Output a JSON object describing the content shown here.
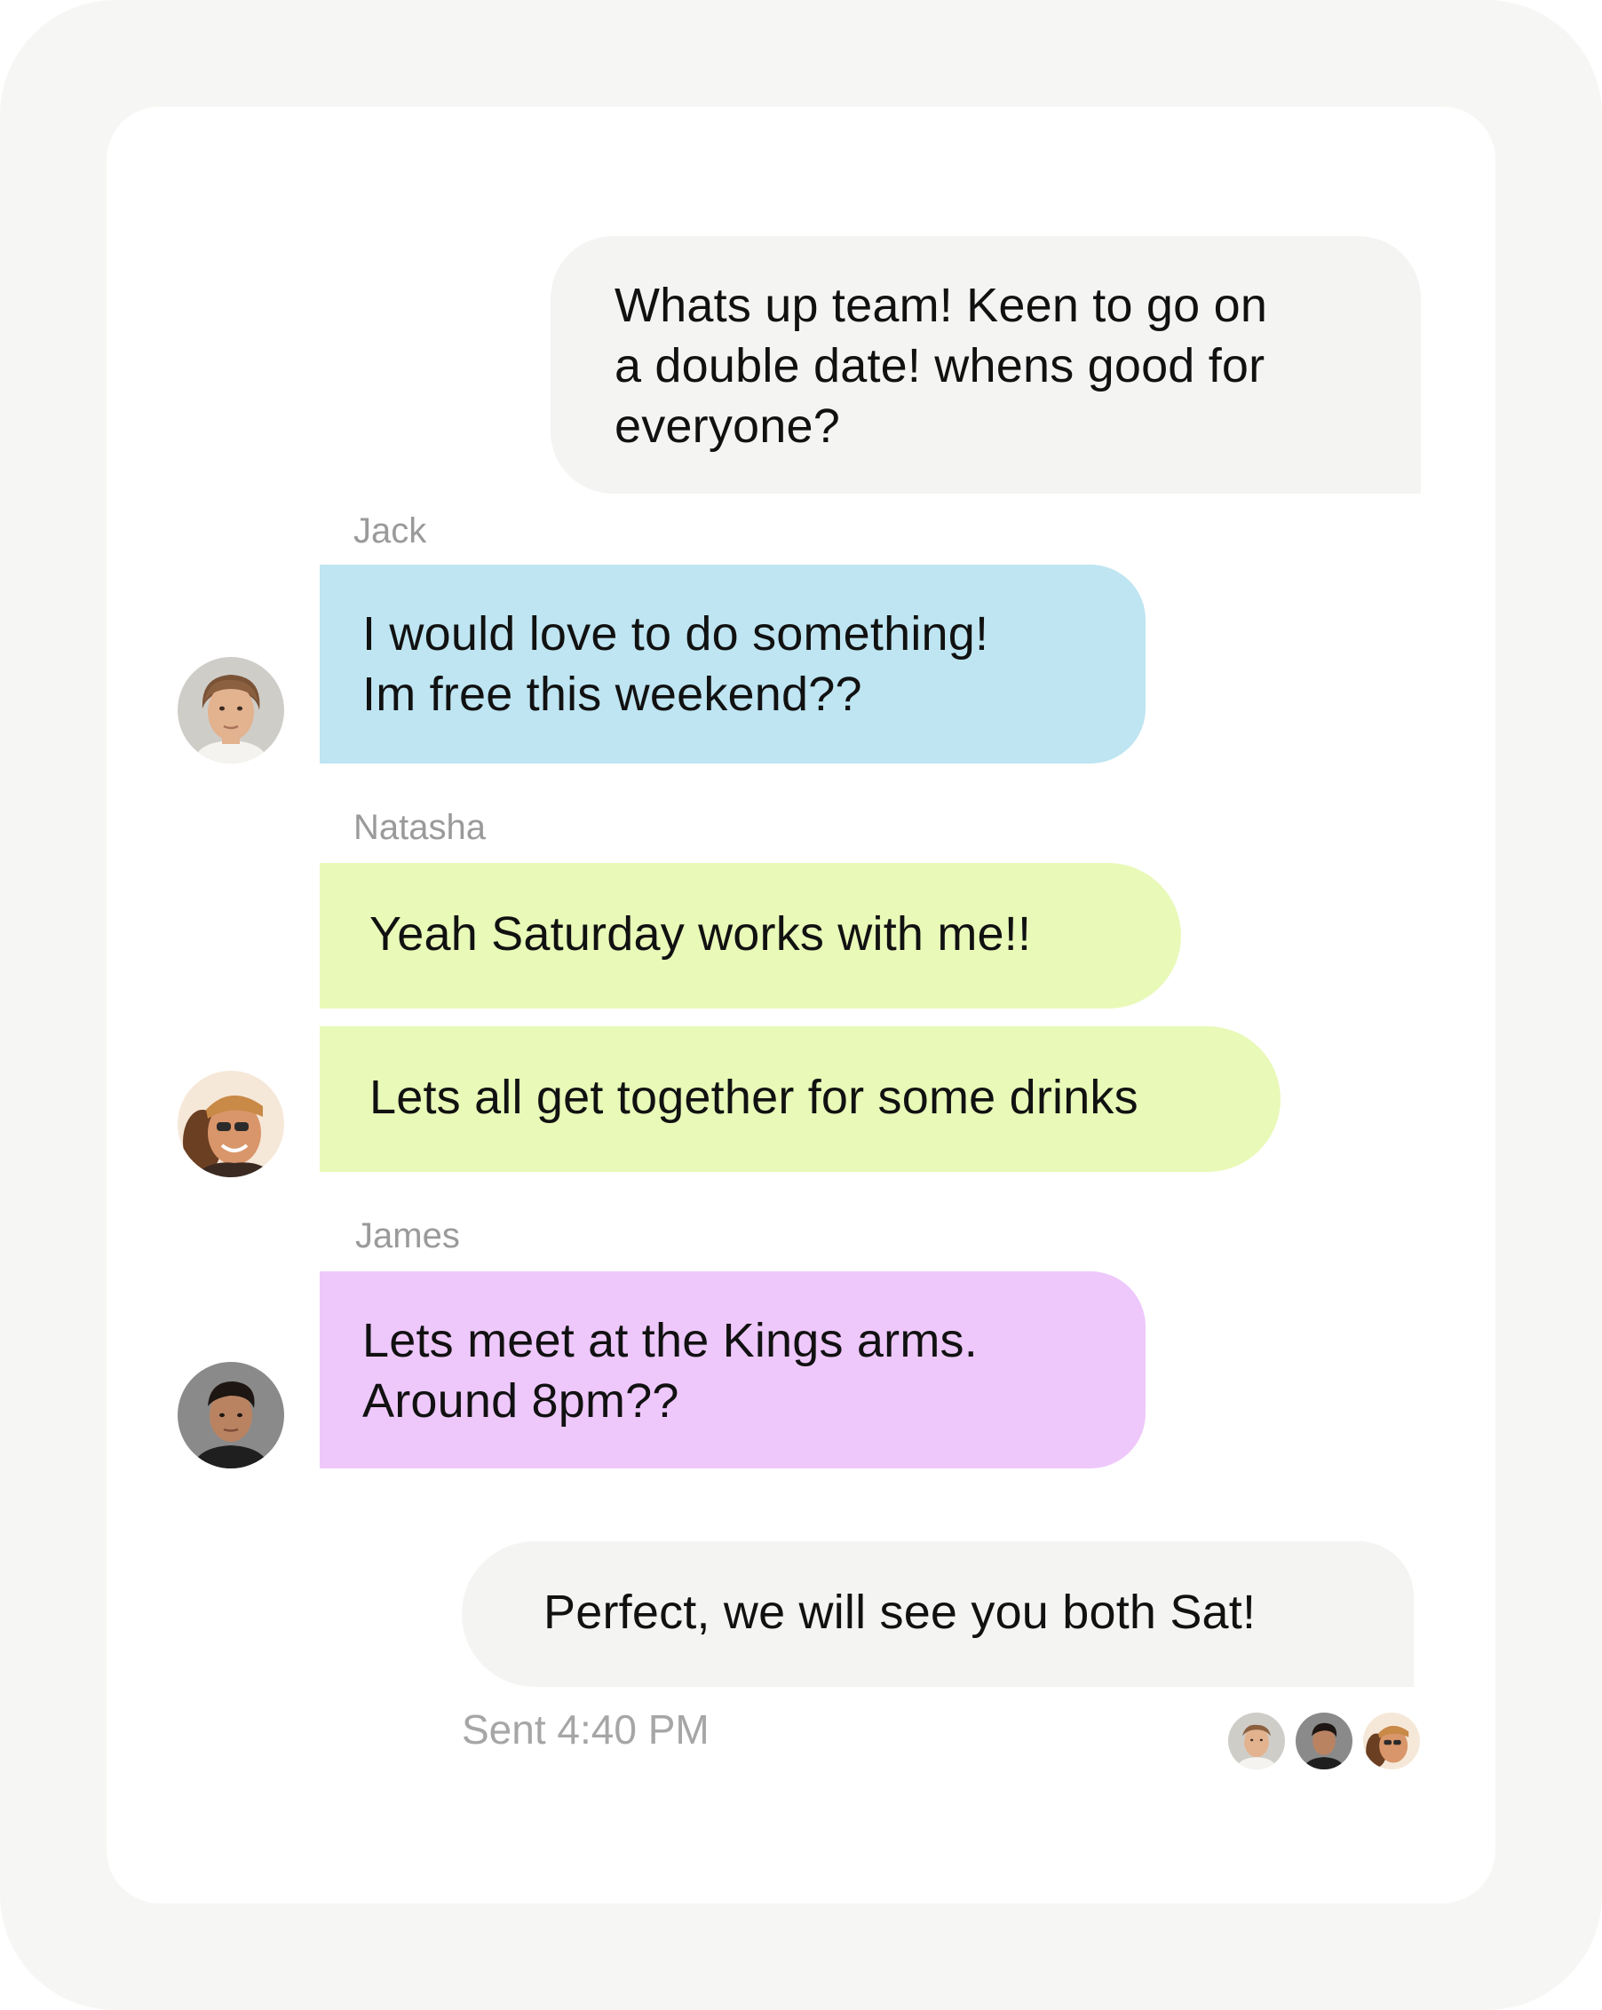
{
  "chat": {
    "messages": [
      {
        "sender": "",
        "text": "Whats up team! Keen to go on\na double date! whens good for\neveryone?",
        "outgoing": true,
        "color": "#f4f4f2"
      },
      {
        "sender": "Jack",
        "text": "I would love to do something!\nIm free this weekend??",
        "outgoing": false,
        "color": "#bee5f1"
      },
      {
        "sender": "Natasha",
        "text": "Yeah Saturday works with me!!",
        "outgoing": false,
        "color": "#e8f9b8"
      },
      {
        "sender": "",
        "text": "Lets all get together for some drinks",
        "outgoing": false,
        "color": "#e8f9b8"
      },
      {
        "sender": "James",
        "text": "Lets meet at the Kings arms.\nAround 8pm??",
        "outgoing": false,
        "color": "#eec8fb"
      },
      {
        "sender": "",
        "text": "Perfect, we will see you both Sat!",
        "outgoing": true,
        "color": "#f4f4f2"
      }
    ],
    "avatars": {
      "jack": "jack-avatar-icon",
      "natasha": "natasha-avatar-icon",
      "james": "james-avatar-icon"
    },
    "status": "Sent 4:40 PM",
    "read_receipts": [
      "jack",
      "james",
      "natasha"
    ]
  }
}
